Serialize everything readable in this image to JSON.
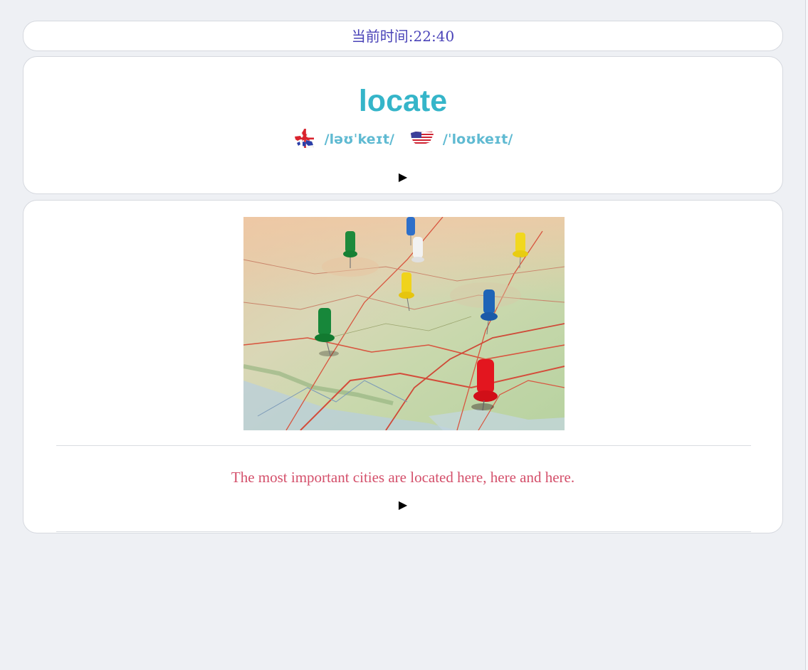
{
  "header": {
    "time_label": "当前时间:",
    "time_value": "22:40"
  },
  "word_card": {
    "word": "locate",
    "uk_phonetic": "/ləʊˈkeɪt/",
    "us_phonetic": "/ˈloʊkeɪt/",
    "uk_flag_icon": "uk-flag-icon",
    "us_flag_icon": "us-flag-icon",
    "play_glyph": "▶"
  },
  "example_card": {
    "image_icon": "map-with-pins-photo",
    "sentence": "The most important cities are located here, here and here.",
    "play_glyph": "▶"
  },
  "colors": {
    "background": "#eef0f4",
    "time_text": "#4a43b8",
    "word": "#35b5c9",
    "phonetic": "#5fbad2",
    "sentence": "#d4506b"
  }
}
